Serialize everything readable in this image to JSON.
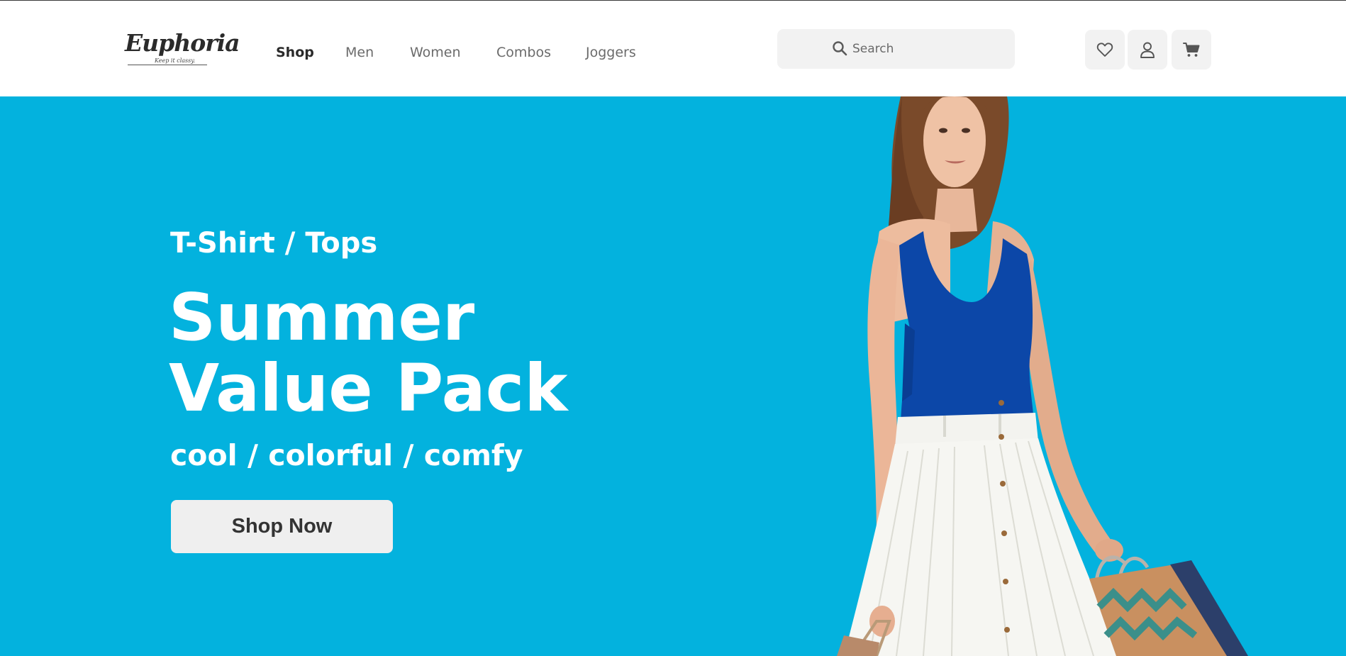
{
  "brand": {
    "name": "Euphoria",
    "tagline": "Keep it classy."
  },
  "nav": {
    "items": [
      {
        "label": "Shop",
        "active": true
      },
      {
        "label": "Men",
        "active": false
      },
      {
        "label": "Women",
        "active": false
      },
      {
        "label": "Combos",
        "active": false
      },
      {
        "label": "Joggers",
        "active": false
      }
    ]
  },
  "search": {
    "placeholder": "Search",
    "value": "",
    "icon": "search-icon"
  },
  "header_actions": [
    {
      "name": "wishlist-button",
      "icon": "heart-icon"
    },
    {
      "name": "account-button",
      "icon": "user-icon"
    },
    {
      "name": "cart-button",
      "icon": "cart-icon"
    }
  ],
  "hero": {
    "category": "T-Shirt / Tops",
    "title_line1": "Summer",
    "title_line2": "Value Pack",
    "tagline": "cool / colorful / comfy",
    "cta_label": "Shop Now"
  },
  "colors": {
    "hero_background": "#03b2de",
    "header_background": "#ffffff",
    "button_background": "#efefef",
    "icon_button_background": "#f2f2f2",
    "text_dark": "#2a2a2a",
    "text_muted": "#6b6b6b"
  }
}
